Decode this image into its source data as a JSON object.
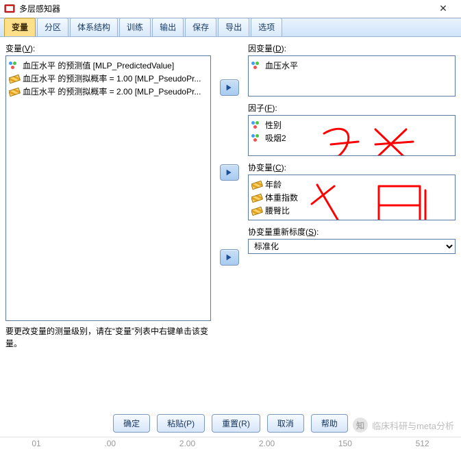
{
  "title": "多层感知器",
  "tabs": [
    "变量",
    "分区",
    "体系结构",
    "训练",
    "输出",
    "保存",
    "导出",
    "选项"
  ],
  "active_tab": "变量",
  "left": {
    "label_prefix": "变量(",
    "label_ul": "V",
    "label_suffix": "):",
    "items": [
      {
        "icon": "circles",
        "text": "血压水平 的预测值 [MLP_PredictedValue]"
      },
      {
        "icon": "ruler",
        "text": "血压水平 的预测拟概率 = 1.00 [MLP_PseudoPr..."
      },
      {
        "icon": "ruler",
        "text": "血压水平 的预测拟概率 = 2.00 [MLP_PseudoPr..."
      }
    ],
    "hint": "要更改变量的测量级别，请在“变量”列表中右键单击该变量。"
  },
  "right": {
    "dep": {
      "label_prefix": "因变量(",
      "label_ul": "D",
      "label_suffix": "):",
      "items": [
        {
          "icon": "circles",
          "text": "血压水平"
        }
      ]
    },
    "factors": {
      "label_prefix": "因子(",
      "label_ul": "F",
      "label_suffix": "):",
      "items": [
        {
          "icon": "circles",
          "text": "性别"
        },
        {
          "icon": "circles",
          "text": "吸烟2"
        }
      ],
      "annotation": "分类"
    },
    "covars": {
      "label_prefix": "协变量(",
      "label_ul": "C",
      "label_suffix": "):",
      "items": [
        {
          "icon": "ruler",
          "text": "年龄"
        },
        {
          "icon": "ruler",
          "text": "体重指数"
        },
        {
          "icon": "ruler",
          "text": "腰臀比"
        }
      ],
      "annotation": "定量"
    },
    "rescale": {
      "label_prefix": "协变量重新标度(",
      "label_ul": "S",
      "label_suffix": "):",
      "selected": "标准化"
    }
  },
  "buttons": {
    "ok": "确定",
    "paste": "粘贴(P)",
    "reset": "重置(R)",
    "cancel": "取消",
    "help": "帮助"
  },
  "watermark": "临床科研与meta分析",
  "footer_ticks": [
    "01",
    ".00",
    "2.00",
    "2.00",
    "150",
    "512"
  ]
}
